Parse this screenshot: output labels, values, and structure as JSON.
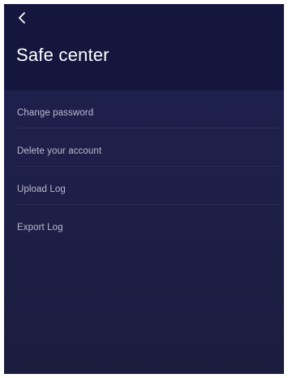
{
  "header": {
    "title": "Safe center",
    "back_icon": "chevron-left-icon"
  },
  "menu": {
    "items": [
      {
        "label": "Change password"
      },
      {
        "label": "Delete your account"
      },
      {
        "label": "Upload Log"
      },
      {
        "label": "Export Log"
      }
    ]
  },
  "colors": {
    "header_background": "#15163e",
    "body_background": "#1e1f47",
    "label_text": "#b9bbd0",
    "title_text": "#ffffff"
  }
}
